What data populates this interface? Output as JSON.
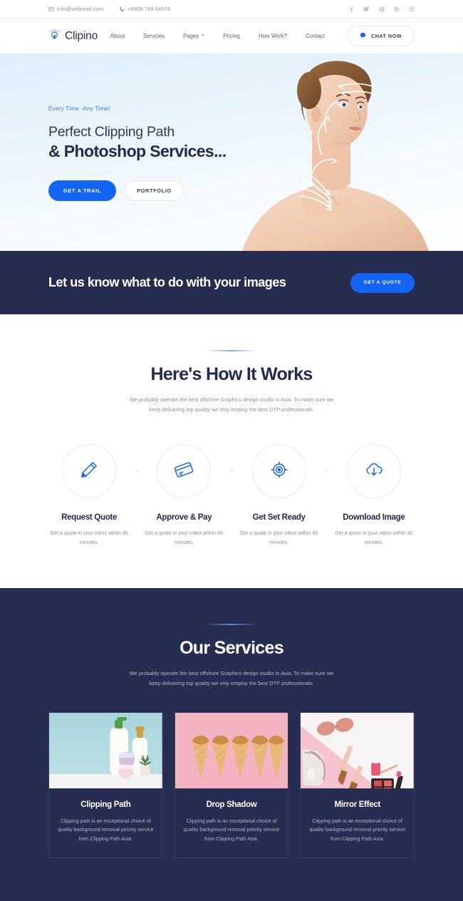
{
  "topbar": {
    "email": "info@webmail.com",
    "phone": "+9908 768 64576",
    "socials": [
      {
        "name": "facebook-icon"
      },
      {
        "name": "twitter-icon"
      },
      {
        "name": "pinterest-icon"
      },
      {
        "name": "dribbble-icon"
      },
      {
        "name": "instagram-icon"
      }
    ]
  },
  "header": {
    "logo_text": "Clipino",
    "nav": [
      {
        "label": "About",
        "has_caret": false
      },
      {
        "label": "Servcies",
        "has_caret": false
      },
      {
        "label": "Pages",
        "has_caret": true
      },
      {
        "label": "Pricing",
        "has_caret": false
      },
      {
        "label": "How Work?",
        "has_caret": false
      },
      {
        "label": "Contact",
        "has_caret": false
      }
    ],
    "chat_label": "CHAT NOW"
  },
  "hero": {
    "eyebrow": "Every Time -Any Time!",
    "title_line1": "Perfect Clipping Path",
    "title_line2": "& Photoshop Services...",
    "primary_btn": "GET A TRAIL",
    "ghost_btn": "PORTFOLIO"
  },
  "cta": {
    "title": "Let us know what to do with your images",
    "button": "GET A QUOTE"
  },
  "how": {
    "title": "Here's How It Works",
    "subtitle": "We probably operate the best offshore Graphics design studio in Asia. To make sure we keep delivering top quality we only employ the best DTP professionals.",
    "arrow": "›",
    "steps": [
      {
        "icon": "pencil-icon",
        "title": "Request Quote",
        "desc": "Get a quote in your inbox within 45 minutes."
      },
      {
        "icon": "credit-card-icon",
        "title": "Approve & Pay",
        "desc": "Get a quote in your inbox within 45 minutes."
      },
      {
        "icon": "target-icon",
        "title": "Get Set Ready",
        "desc": "Get a quote in your inbox within 45 minutes."
      },
      {
        "icon": "cloud-download-icon",
        "title": "Download Image",
        "desc": "Get a quote in your inbox within 45 minutes."
      }
    ]
  },
  "services": {
    "title": "Our Services",
    "subtitle": "We probably operate the best offshore Graphics design studio in Asia. To make sure we keep delivering top quality we only employ the best DTP professionals.",
    "cards": [
      {
        "image": "cosmetic-bottles-photo",
        "title": "Clipping Path",
        "desc": "Clipping path is an exceptional choice of quality background removal priority service from Clipping Path Asia."
      },
      {
        "image": "ice-cream-cones-photo",
        "title": "Drop Shadow",
        "desc": "Clipping path is an exceptional choice of quality background removal priority service from Clipping Path Asia."
      },
      {
        "image": "beauty-accessories-photo",
        "title": "Mirror Effect",
        "desc": "Clipping path is an exceptional choice of quality background removal priority service from Clipping Path Asia."
      }
    ]
  },
  "colors": {
    "accent": "#1565f5",
    "dark": "#272d50",
    "eyebrow": "#3d7ef0",
    "muted": "#8b90a0"
  }
}
